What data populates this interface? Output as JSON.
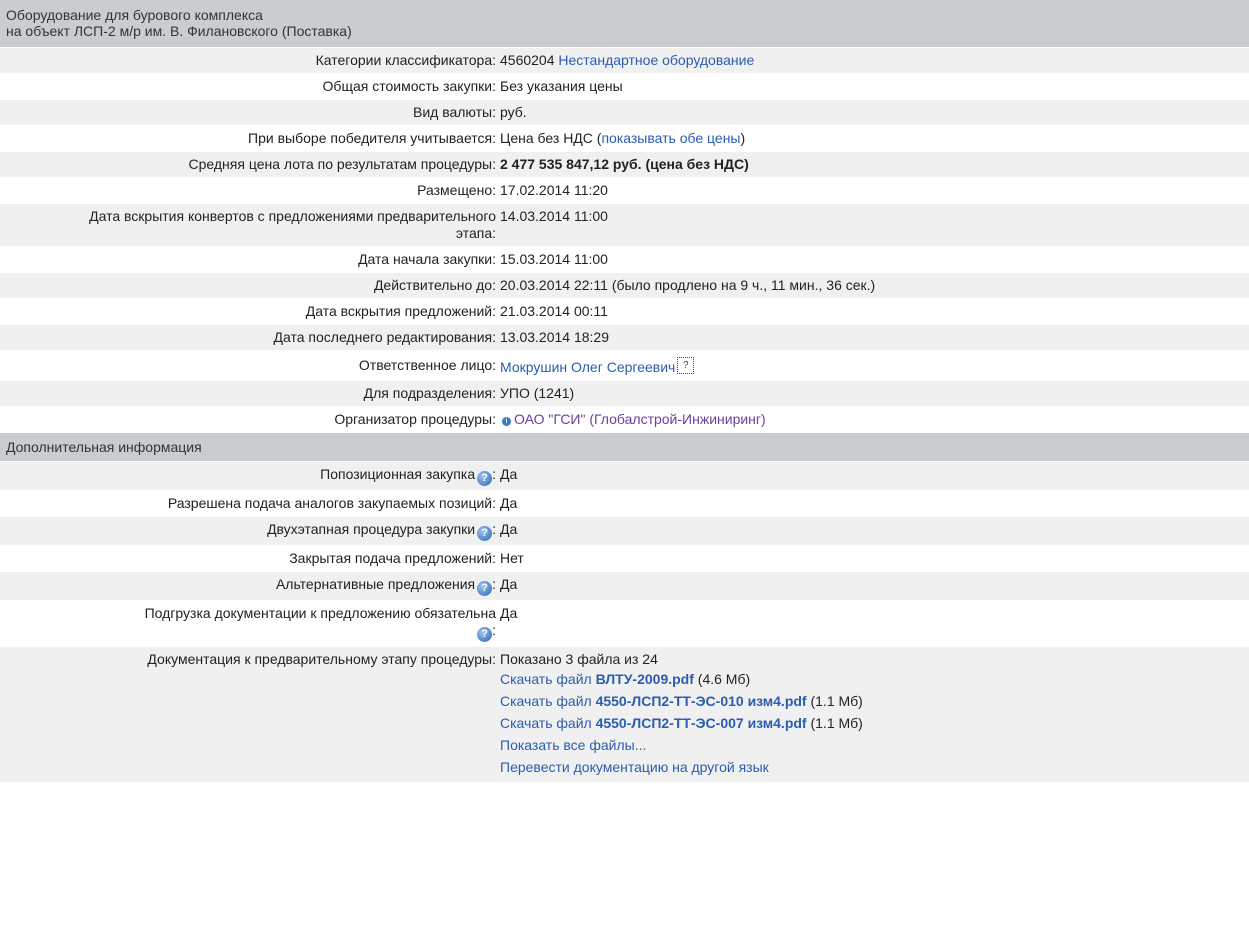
{
  "header": {
    "line1": "Оборудование для бурового комплекса",
    "line2": "на объект ЛСП-2 м/р им. В. Филановского (Поставка)"
  },
  "main": {
    "classifier_label": "Категории классификатора:",
    "classifier_code": "4560204",
    "classifier_name": "Нестандартное оборудование",
    "total_label": "Общая стоимость закупки:",
    "total_value": "Без указания цены",
    "currency_label": "Вид валюты:",
    "currency_value": "руб.",
    "winner_label": "При выборе победителя учитывается:",
    "winner_value": "Цена без НДС (",
    "winner_link": "показывать обе цены",
    "winner_close": ")",
    "avgprice_label": "Средняя цена лота по результатам процедуры:",
    "avgprice_value": "2 477 535 847,12 руб. (цена без НДС)",
    "posted_label": "Размещено:",
    "posted_value": "17.02.2014 11:20",
    "envelopes_label": "Дата вскрытия конвертов с предложениями предварительного этапа:",
    "envelopes_value": "14.03.2014 11:00",
    "start_label": "Дата начала закупки:",
    "start_value": "15.03.2014 11:00",
    "valid_label": "Действительно до:",
    "valid_value": "20.03.2014 22:11 (было продлено на 9 ч., 11 мин., 36 сек.)",
    "opening_label": "Дата вскрытия предложений:",
    "opening_value": "21.03.2014 00:11",
    "edited_label": "Дата последнего редактирования:",
    "edited_value": "13.03.2014 18:29",
    "responsible_label": "Ответственное лицо:",
    "responsible_value": "Мокрушин Олег Сергеевич",
    "responsible_help": "?",
    "division_label": "Для подразделения:",
    "division_value": "УПО (1241)",
    "organizer_label": "Организатор процедуры:",
    "organizer_value": "ОАО \"ГСИ\" (Глобалстрой-Инжиниринг)"
  },
  "additional": {
    "title": "Дополнительная информация",
    "itemized_label": "Попозиционная закупка",
    "itemized_value": "Да",
    "analogs_label": "Разрешена подача аналогов закупаемых позиций:",
    "analogs_value": "Да",
    "twostage_label": "Двухэтапная процедура закупки",
    "twostage_value": "Да",
    "closed_label": "Закрытая подача предложений:",
    "closed_value": "Нет",
    "alternative_label": "Альтернативные предложения",
    "alternative_value": "Да",
    "upload_label": "Подгрузка документации к предложению обязательна",
    "upload_value": "Да",
    "docs_label": "Документация к предварительному этапу процедуры:",
    "docs_summary": "Показано 3 файла из 24",
    "download_prefix": "Скачать файл",
    "files": [
      {
        "name": "ВЛТУ-2009.pdf",
        "size": "(4.6 Мб)"
      },
      {
        "name": "4550-ЛСП2-ТТ-ЭС-010 изм4.pdf",
        "size": "(1.1 Мб)"
      },
      {
        "name": "4550-ЛСП2-ТТ-ЭС-007 изм4.pdf",
        "size": "(1.1 Мб)"
      }
    ],
    "show_all": "Показать все файлы...",
    "translate": "Перевести документацию на другой язык"
  },
  "colors": {
    "header_bg": "#c9cdd2",
    "row_alt_bg": "#f0f0f0",
    "link": "#2a5db0",
    "organizer_link": "#6b3fa0"
  },
  "icons": {
    "help": "help-icon",
    "question_box": "question-box-icon",
    "info": "info-icon"
  }
}
